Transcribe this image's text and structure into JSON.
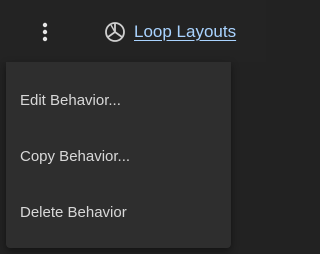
{
  "topbar": {
    "more_icon": "vertical-ellipsis-icon",
    "loop_link": {
      "icon": "loop-layouts-icon",
      "label": "Loop Layouts",
      "color": "#a9d3ff"
    }
  },
  "menu": {
    "items": [
      {
        "label": "Edit Behavior..."
      },
      {
        "label": "Copy Behavior..."
      },
      {
        "label": "Delete Behavior"
      }
    ]
  },
  "colors": {
    "background": "#222222",
    "menu_background": "#2e2e2e",
    "menu_text": "#d8d8d8"
  }
}
